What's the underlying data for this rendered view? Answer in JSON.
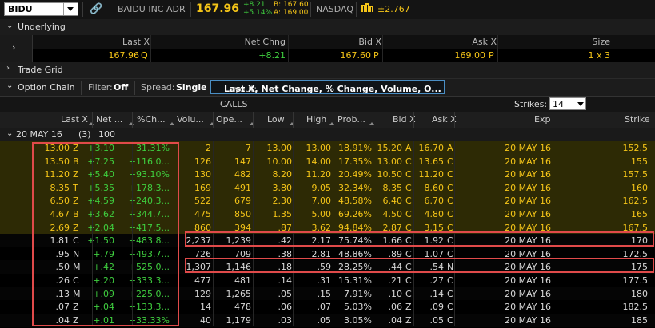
{
  "topbar": {
    "symbol": "BIDU",
    "company": "BAIDU INC ADR",
    "last": "167.96",
    "net_change": "+8.21",
    "pct_change": "+5.14%",
    "bid": "B: 167.60",
    "ask": "A: 169.00",
    "exchange": "NASDAQ",
    "mm_icon": "mm-icon",
    "market_maker_move": "±2.767"
  },
  "underlying": {
    "section_label": "Underlying",
    "headers": [
      "Last X",
      "Net Chng",
      "Bid X",
      "Ask X",
      "Size"
    ],
    "values": {
      "last": "167.96",
      "last_ex": "Q",
      "net_chng": "+8.21",
      "bid": "167.60",
      "bid_ex": "P",
      "ask": "169.00",
      "ask_ex": "P",
      "size": "1 x 3"
    }
  },
  "trade_grid": {
    "label": "Trade Grid"
  },
  "option_chain": {
    "label": "Option Chain",
    "filter_label": "Filter:",
    "filter_value": "Off",
    "spread_label": "Spread:",
    "spread_value": "Single",
    "layout_label": "Layout:",
    "layout_value": "Last X, Net Change, % Change, Volume, O..."
  },
  "calls_header": "CALLS",
  "strikes": {
    "label": "Strikes:",
    "value": "14"
  },
  "columns": [
    "Last X",
    "Net ...",
    "%Ch...",
    "Volu...",
    "Ope...",
    "Low",
    "High",
    "Prob...",
    "Bid X",
    "Ask X",
    "Exp",
    "Strike"
  ],
  "expiry_group": {
    "label": "20 MAY 16",
    "count": "(3)",
    "multiplier": "100"
  },
  "rows": [
    {
      "last": "13.00",
      "lx": "Z",
      "net": "+3.10",
      "pct": "+31.31%",
      "vol": "2",
      "oi": "7",
      "low": "13.00",
      "high": "13.00",
      "prob": "18.91%",
      "bid": "15.20",
      "bx": "A",
      "ask": "16.70",
      "ax": "A",
      "exp": "20 MAY 16",
      "strike": "152.5"
    },
    {
      "last": "13.50",
      "lx": "B",
      "net": "+7.25",
      "pct": "+116.0...",
      "vol": "126",
      "oi": "147",
      "low": "10.00",
      "high": "14.00",
      "prob": "17.35%",
      "bid": "13.00",
      "bx": "C",
      "ask": "13.65",
      "ax": "C",
      "exp": "20 MAY 16",
      "strike": "155"
    },
    {
      "last": "11.20",
      "lx": "Z",
      "net": "+5.40",
      "pct": "+93.10%",
      "vol": "130",
      "oi": "482",
      "low": "8.20",
      "high": "11.20",
      "prob": "20.49%",
      "bid": "10.50",
      "bx": "C",
      "ask": "11.20",
      "ax": "C",
      "exp": "20 MAY 16",
      "strike": "157.5"
    },
    {
      "last": "8.35",
      "lx": "T",
      "net": "+5.35",
      "pct": "+178.3...",
      "vol": "169",
      "oi": "491",
      "low": "3.80",
      "high": "9.05",
      "prob": "32.34%",
      "bid": "8.35",
      "bx": "C",
      "ask": "8.60",
      "ax": "C",
      "exp": "20 MAY 16",
      "strike": "160"
    },
    {
      "last": "6.50",
      "lx": "Z",
      "net": "+4.59",
      "pct": "+240.3...",
      "vol": "522",
      "oi": "679",
      "low": "2.30",
      "high": "7.00",
      "prob": "48.58%",
      "bid": "6.40",
      "bx": "C",
      "ask": "6.70",
      "ax": "C",
      "exp": "20 MAY 16",
      "strike": "162.5"
    },
    {
      "last": "4.67",
      "lx": "B",
      "net": "+3.62",
      "pct": "+344.7...",
      "vol": "475",
      "oi": "850",
      "low": "1.35",
      "high": "5.00",
      "prob": "69.26%",
      "bid": "4.50",
      "bx": "C",
      "ask": "4.80",
      "ax": "C",
      "exp": "20 MAY 16",
      "strike": "165"
    },
    {
      "last": "2.69",
      "lx": "Z",
      "net": "+2.04",
      "pct": "+417.5...",
      "vol": "860",
      "oi": "394",
      "low": ".87",
      "high": "3.62",
      "prob": "94.84%",
      "bid": "2.87",
      "bx": "C",
      "ask": "3.15",
      "ax": "C",
      "exp": "20 MAY 16",
      "strike": "167.5"
    },
    {
      "last": "1.81",
      "lx": "C",
      "net": "+1.50",
      "pct": "+483.8...",
      "vol": "2,237",
      "oi": "1,239",
      "low": ".42",
      "high": "2.17",
      "prob": "75.74%",
      "bid": "1.66",
      "bx": "C",
      "ask": "1.92",
      "ax": "C",
      "exp": "20 MAY 16",
      "strike": "170"
    },
    {
      "last": ".95",
      "lx": "N",
      "net": "+.79",
      "pct": "+493.7...",
      "vol": "726",
      "oi": "709",
      "low": ".38",
      "high": "2.81",
      "prob": "48.86%",
      "bid": ".89",
      "bx": "C",
      "ask": "1.07",
      "ax": "C",
      "exp": "20 MAY 16",
      "strike": "172.5"
    },
    {
      "last": ".50",
      "lx": "M",
      "net": "+.42",
      "pct": "+525.0...",
      "vol": "1,307",
      "oi": "1,146",
      "low": ".18",
      "high": ".59",
      "prob": "28.25%",
      "bid": ".44",
      "bx": "C",
      "ask": ".54",
      "ax": "N",
      "exp": "20 MAY 16",
      "strike": "175"
    },
    {
      "last": ".26",
      "lx": "C",
      "net": "+.20",
      "pct": "+333.3...",
      "vol": "477",
      "oi": "481",
      "low": ".14",
      "high": ".31",
      "prob": "15.31%",
      "bid": ".21",
      "bx": "C",
      "ask": ".27",
      "ax": "C",
      "exp": "20 MAY 16",
      "strike": "177.5"
    },
    {
      "last": ".13",
      "lx": "M",
      "net": "+.09",
      "pct": "+225.0...",
      "vol": "129",
      "oi": "1,265",
      "low": ".05",
      "high": ".15",
      "prob": "7.91%",
      "bid": ".10",
      "bx": "C",
      "ask": ".14",
      "ax": "C",
      "exp": "20 MAY 16",
      "strike": "180"
    },
    {
      "last": ".07",
      "lx": "Z",
      "net": "+.04",
      "pct": "+133.3...",
      "vol": "14",
      "oi": "478",
      "low": ".06",
      "high": ".07",
      "prob": "5.03%",
      "bid": ".06",
      "bx": "Z",
      "ask": ".09",
      "ax": "C",
      "exp": "20 MAY 16",
      "strike": "182.5"
    },
    {
      "last": ".04",
      "lx": "Z",
      "net": "+.01",
      "pct": "+33.33%",
      "vol": "40",
      "oi": "1,179",
      "low": ".03",
      "high": ".05",
      "prob": "3.05%",
      "bid": ".04",
      "bx": "Z",
      "ask": ".05",
      "ax": "C",
      "exp": "20 MAY 16",
      "strike": "185"
    }
  ],
  "colors": {
    "itm_background": "#2d2a05",
    "itm_text": "#f5c518",
    "otm_text": "#d8d8d8",
    "change_positive": "#3fcf3f",
    "highlight_box": "#e04a4a",
    "layout_border": "#4a8ec4"
  }
}
